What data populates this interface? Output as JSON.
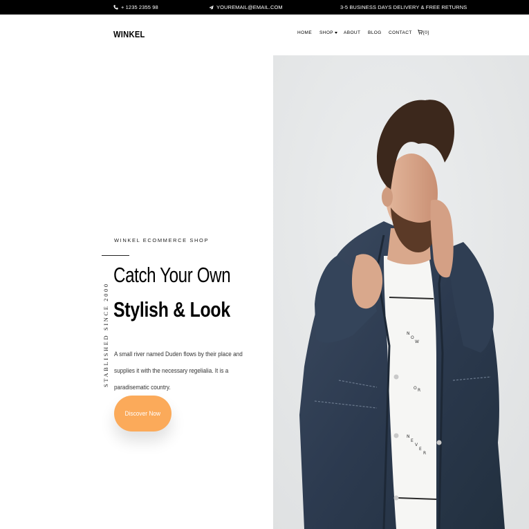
{
  "topbar": {
    "phone": "+ 1235 2355 98",
    "email": "YOUREMAIL@EMAIL.COM",
    "delivery": "3-5 BUSINESS DAYS DELIVERY & FREE RETURNS",
    "phone_icon": "phone-icon",
    "email_icon": "paper-plane-icon"
  },
  "navbar": {
    "brand": "WINKEL",
    "items": [
      {
        "label": "HOME"
      },
      {
        "label": "SHOP"
      },
      {
        "label": "ABOUT"
      },
      {
        "label": "BLOG"
      },
      {
        "label": "CONTACT"
      }
    ],
    "cart_count": "[0]",
    "cart_icon": "cart-icon"
  },
  "hero": {
    "tagline": "WINKEL ECOMMERCE SHOP",
    "vertical_text": "STABLISHED SINCE 2000",
    "title_light": "Catch Your Own",
    "title_bold": "Stylish & Look",
    "description": "A small river named Duden flows by their place and supplies it with the necessary regelialia. It is a paradisematic country.",
    "button_label": "Discover Now",
    "shirt_text": [
      "N",
      "O",
      "W",
      "O",
      "R",
      "N",
      "E",
      "V",
      "E",
      "R"
    ]
  },
  "colors": {
    "topbar_bg": "#000000",
    "accent": "#fbaa5a",
    "photo_bg": "#e6e8e9"
  }
}
